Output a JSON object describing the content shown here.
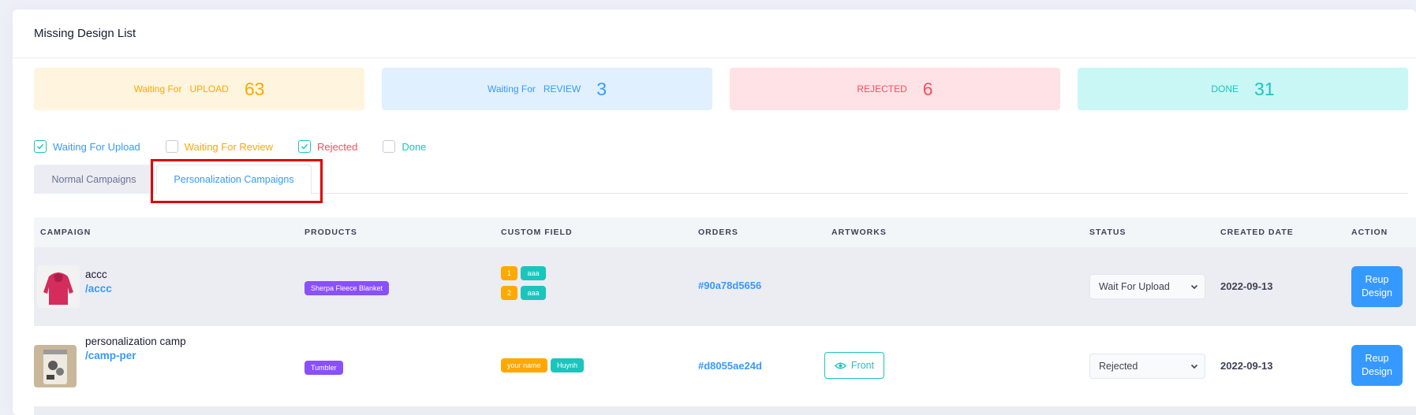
{
  "page": {
    "title": "Missing Design List"
  },
  "stats": [
    {
      "prefix": "Waiting For",
      "label": "UPLOAD",
      "count": "63",
      "bg": "#fff4de",
      "color": "#ffa800"
    },
    {
      "prefix": "Waiting For",
      "label": "REVIEW",
      "count": "3",
      "bg": "#e1f0ff",
      "color": "#3699ff"
    },
    {
      "prefix": "",
      "label": "REJECTED",
      "count": "6",
      "bg": "#ffe2e5",
      "color": "#f64e60"
    },
    {
      "prefix": "",
      "label": "DONE",
      "count": "31",
      "bg": "#c9f7f5",
      "color": "#1bc5bd"
    }
  ],
  "filters": [
    {
      "label": "Waiting For Upload",
      "checked": true,
      "color": "#3699ff"
    },
    {
      "label": "Waiting For Review",
      "checked": false,
      "color": "#ffa800"
    },
    {
      "label": "Rejected",
      "checked": true,
      "color": "#f64e60"
    },
    {
      "label": "Done",
      "checked": false,
      "color": "#1bc5bd"
    }
  ],
  "tabs": [
    {
      "label": "Normal Campaigns",
      "active": false
    },
    {
      "label": "Personalization Campaigns",
      "active": true
    }
  ],
  "table": {
    "headers": [
      "CAMPAIGN",
      "PRODUCTS",
      "CUSTOM FIELD",
      "ORDERS",
      "ARTWORKS",
      "STATUS",
      "CREATED DATE",
      "ACTION"
    ],
    "rows": [
      {
        "name": "accc",
        "slug": "/accc",
        "thumb": "hoodie-image",
        "product": "Sherpa Fleece Blanket",
        "custom_fields": [
          [
            "1",
            "aaa"
          ],
          [
            "2",
            "aaa"
          ]
        ],
        "order": "#90a78d5656",
        "artwork": "",
        "status": "Wait For Upload",
        "created": "2022-09-13",
        "action": [
          "Reup",
          "Design"
        ]
      },
      {
        "name": "personalization camp",
        "slug": "/camp-per",
        "thumb": "tumbler-image",
        "product": "Tumbler",
        "custom_fields": [
          [
            "your name",
            "Huynh"
          ]
        ],
        "order": "#d8055ae24d",
        "artwork": "Front",
        "status": "Rejected",
        "created": "2022-09-13",
        "action": [
          "Reup",
          "Design"
        ]
      }
    ]
  }
}
